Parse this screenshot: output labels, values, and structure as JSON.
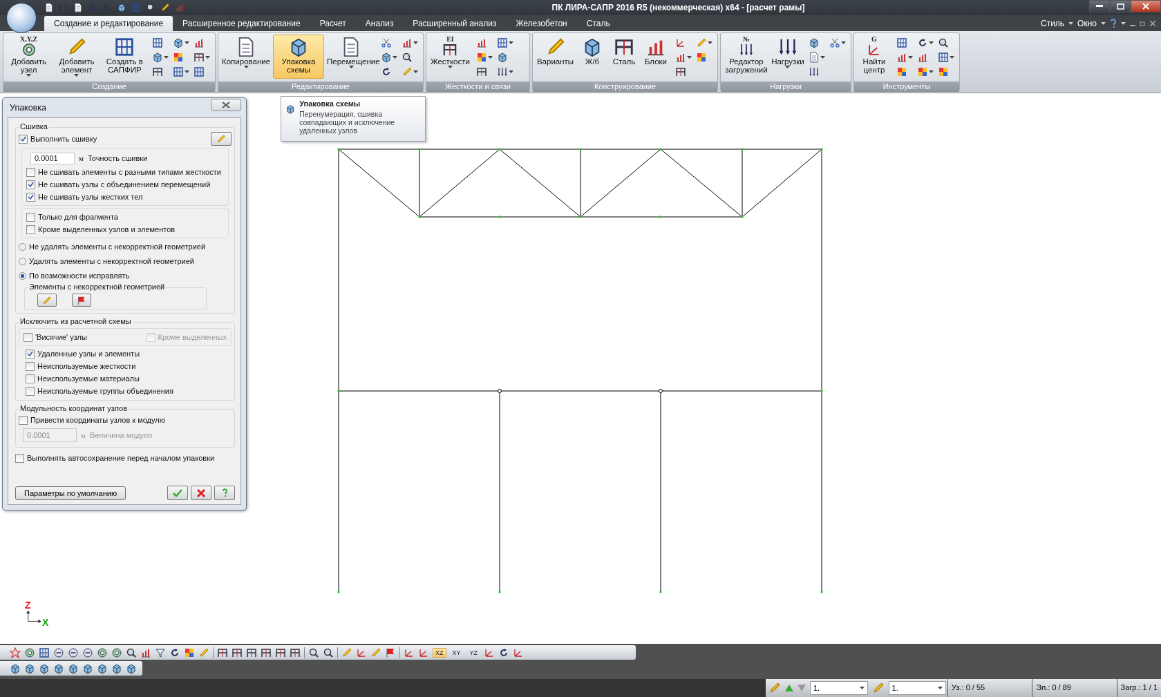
{
  "window": {
    "title": "ПК ЛИРА-САПР  2016 R5 (некоммерческая) x64 - [расчет рамы]"
  },
  "ribbon_tabs": [
    {
      "label": "Создание и редактирование",
      "selected": true
    },
    {
      "label": "Расширенное редактирование",
      "selected": false
    },
    {
      "label": "Расчет",
      "selected": false
    },
    {
      "label": "Анализ",
      "selected": false
    },
    {
      "label": "Расширенный анализ",
      "selected": false
    },
    {
      "label": "Железобетон",
      "selected": false
    },
    {
      "label": "Сталь",
      "selected": false
    }
  ],
  "menu_right": [
    "Стиль",
    "Окно"
  ],
  "ribbon_groups": [
    {
      "title": "Создание",
      "buttons": [
        {
          "label": "Добавить узел",
          "icon_caption": "X,Y,Z",
          "dropdown": true,
          "selected": false
        },
        {
          "label": "Добавить элемент",
          "dropdown": true,
          "selected": false
        },
        {
          "label": "Создать в САПФИР",
          "dropdown": false,
          "selected": false
        }
      ]
    },
    {
      "title": "Редактирование",
      "buttons": [
        {
          "label": "Копирование",
          "dropdown": true,
          "selected": false
        },
        {
          "label": "Упаковка схемы",
          "dropdown": false,
          "selected": true
        },
        {
          "label": "Перемещение",
          "dropdown": true,
          "selected": false
        }
      ]
    },
    {
      "title": "Жесткости и связи",
      "buttons": [
        {
          "label": "Жесткости",
          "icon_caption": "EI",
          "dropdown": true,
          "selected": false
        }
      ]
    },
    {
      "title": "Конструирование",
      "buttons": [
        {
          "label": "Варианты",
          "dropdown": false,
          "selected": false
        },
        {
          "label": "Ж/б",
          "dropdown": false,
          "selected": false
        },
        {
          "label": "Сталь",
          "dropdown": false,
          "selected": false
        },
        {
          "label": "Блоки",
          "dropdown": false,
          "selected": false
        }
      ]
    },
    {
      "title": "Нагрузки",
      "buttons": [
        {
          "label": "Редактор загружений",
          "icon_caption": "№",
          "dropdown": false,
          "selected": false
        },
        {
          "label": "Нагрузки",
          "dropdown": true,
          "selected": false
        }
      ]
    },
    {
      "title": "Инструменты",
      "buttons": [
        {
          "label": "Найти центр",
          "icon_caption": "G",
          "dropdown": false,
          "selected": false
        }
      ]
    }
  ],
  "tooltip": {
    "title": "Упаковка схемы",
    "text": "Перенумерация, сшивка совпадающих и исключение удаленных узлов"
  },
  "dialog": {
    "title": "Упаковка",
    "stitch": {
      "legend": "Сшивка",
      "enable": {
        "label": "Выполнить сшивку",
        "checked": true
      },
      "precision": {
        "value": "0.0001",
        "unit": "м",
        "label": "Точность сшивки"
      },
      "options": [
        {
          "label": "Не сшивать элементы с разными типами жесткости",
          "checked": false
        },
        {
          "label": "Не сшивать узлы с объединением перемещений",
          "checked": true
        },
        {
          "label": "Не сшивать узлы жестких тел",
          "checked": true
        }
      ],
      "scope": [
        {
          "label": "Только для фрагмента",
          "checked": false
        },
        {
          "label": "Кроме выделенных узлов и элементов",
          "checked": false
        }
      ]
    },
    "geometry_modes": [
      {
        "label": "Не удалять элементы с некорректной геометрией",
        "selected": false
      },
      {
        "label": "Удалять элементы с некорректной геометрией",
        "selected": false
      },
      {
        "label": "По возможности исправлять",
        "selected": true
      }
    ],
    "geometry_group": {
      "legend": "Элементы с некорректной геометрией"
    },
    "exclude": {
      "legend": "Исключить из расчетной схемы",
      "hanging": {
        "label": "'Висячие' узлы",
        "checked": false
      },
      "except_selected": {
        "label": "Кроме выделенных",
        "checked": false,
        "disabled": true
      },
      "options": [
        {
          "label": "Удаленные узлы и элементы",
          "checked": true
        },
        {
          "label": "Неиспользуемые жесткости",
          "checked": false
        },
        {
          "label": "Неиспользуемые материалы",
          "checked": false
        },
        {
          "label": "Неиспользуемые группы объединения",
          "checked": false
        }
      ]
    },
    "modularity": {
      "legend": "Модульность координат узлов",
      "enable": {
        "label": "Привести координаты узлов к модулю",
        "checked": false
      },
      "value": "0.0001",
      "unit": "м",
      "label": "Величина модуля",
      "disabled": true
    },
    "autosave": {
      "label": "Выполнять автосохранение перед началом упаковки",
      "checked": false
    },
    "default_button": "Параметры по умолчанию"
  },
  "axes": {
    "vertical": "Z",
    "horizontal": "X"
  },
  "view_buttons": [
    {
      "label": "XZ",
      "selected": true
    },
    {
      "label": "XY",
      "selected": false
    },
    {
      "label": "YZ",
      "selected": false
    }
  ],
  "status_bar": {
    "load_case": "1.",
    "variant": "1.",
    "nodes": "Уз.: 0 / 55",
    "elements": "Эл.: 0 / 89",
    "loads": "Загр.: 1 / 1"
  }
}
